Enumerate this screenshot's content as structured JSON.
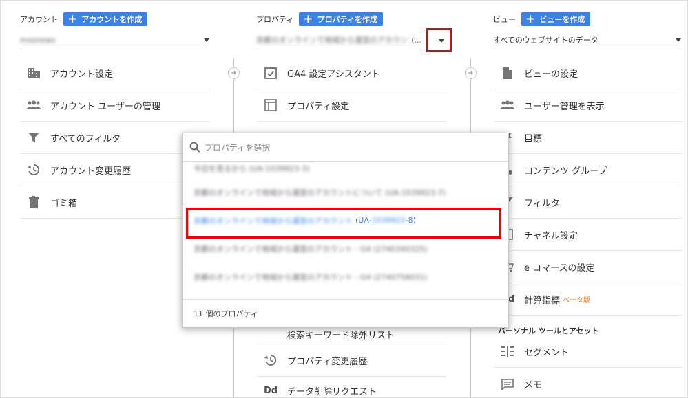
{
  "account": {
    "title": "アカウント",
    "create_label": "アカウントを作成",
    "selected": "mosnews",
    "menu": [
      {
        "icon": "building-icon",
        "label": "アカウント設定"
      },
      {
        "icon": "users-icon",
        "label": "アカウント ユーザーの管理"
      },
      {
        "icon": "filter-icon",
        "label": "すべてのフィルタ"
      },
      {
        "icon": "history-icon",
        "label": "アカウント変更履歴"
      },
      {
        "icon": "trash-icon",
        "label": "ゴミ箱"
      }
    ]
  },
  "property": {
    "title": "プロパティ",
    "create_label": "プロパティを作成",
    "selected": "京都のオンラインで地域から運営のアカウントの物件",
    "selected_suffix": "(...",
    "menu": [
      {
        "icon": "checklist-icon",
        "label": "GA4 設定アシスタント"
      },
      {
        "icon": "window-icon",
        "label": "プロパティ設定"
      }
    ],
    "menu_lower": [
      {
        "icon": "none",
        "label": "検索キーワード除外リスト"
      },
      {
        "icon": "history-icon",
        "label": "プロパティ変更履歴"
      },
      {
        "icon": "dd-icon",
        "label": "データ削除リクエスト"
      }
    ]
  },
  "view": {
    "title": "ビュー",
    "create_label": "ビューを作成",
    "selected": "すべてのウェブサイトのデータ",
    "menu": [
      {
        "icon": "document-icon",
        "label": "ビューの設定"
      },
      {
        "icon": "users-icon",
        "label": "ユーザー管理を表示"
      },
      {
        "icon": "flag-icon",
        "label": "目標"
      },
      {
        "icon": "content-group-icon",
        "label": "コンテンツ グループ"
      },
      {
        "icon": "filter-icon",
        "label": "フィルタ"
      },
      {
        "icon": "channel-icon",
        "label": "チャネル設定"
      },
      {
        "icon": "cart-icon",
        "label": "e コマースの設定"
      },
      {
        "icon": "dd-icon",
        "label": "計算指標",
        "badge": "ベータ版"
      }
    ],
    "section_title": "パーソナル ツールとアセット",
    "personal": [
      {
        "icon": "segment-icon",
        "label": "セグメント"
      },
      {
        "icon": "memo-icon",
        "label": "メモ"
      }
    ]
  },
  "dropdown": {
    "search_placeholder": "プロパティを選択",
    "items": [
      "今日を見るから (UA-1039923-3)",
      "京都のオンラインで地域から運営のアカウントについて (UA-1039923-7)",
      "京都のオンラインで地域から運営のアカウント",
      "京都のオンラインで地域から運営のアカウント - G4 (2740340325)",
      "京都のオンラインで地域から運営のアカウント - G4 (2740758031)"
    ],
    "selected_prefix": "(UA-",
    "selected_suffix": "-8)",
    "count_label": "11 個のプロパティ"
  },
  "colors": {
    "accent": "#3b82e6",
    "highlight": "#ee0000",
    "beta": "#e8771b"
  }
}
